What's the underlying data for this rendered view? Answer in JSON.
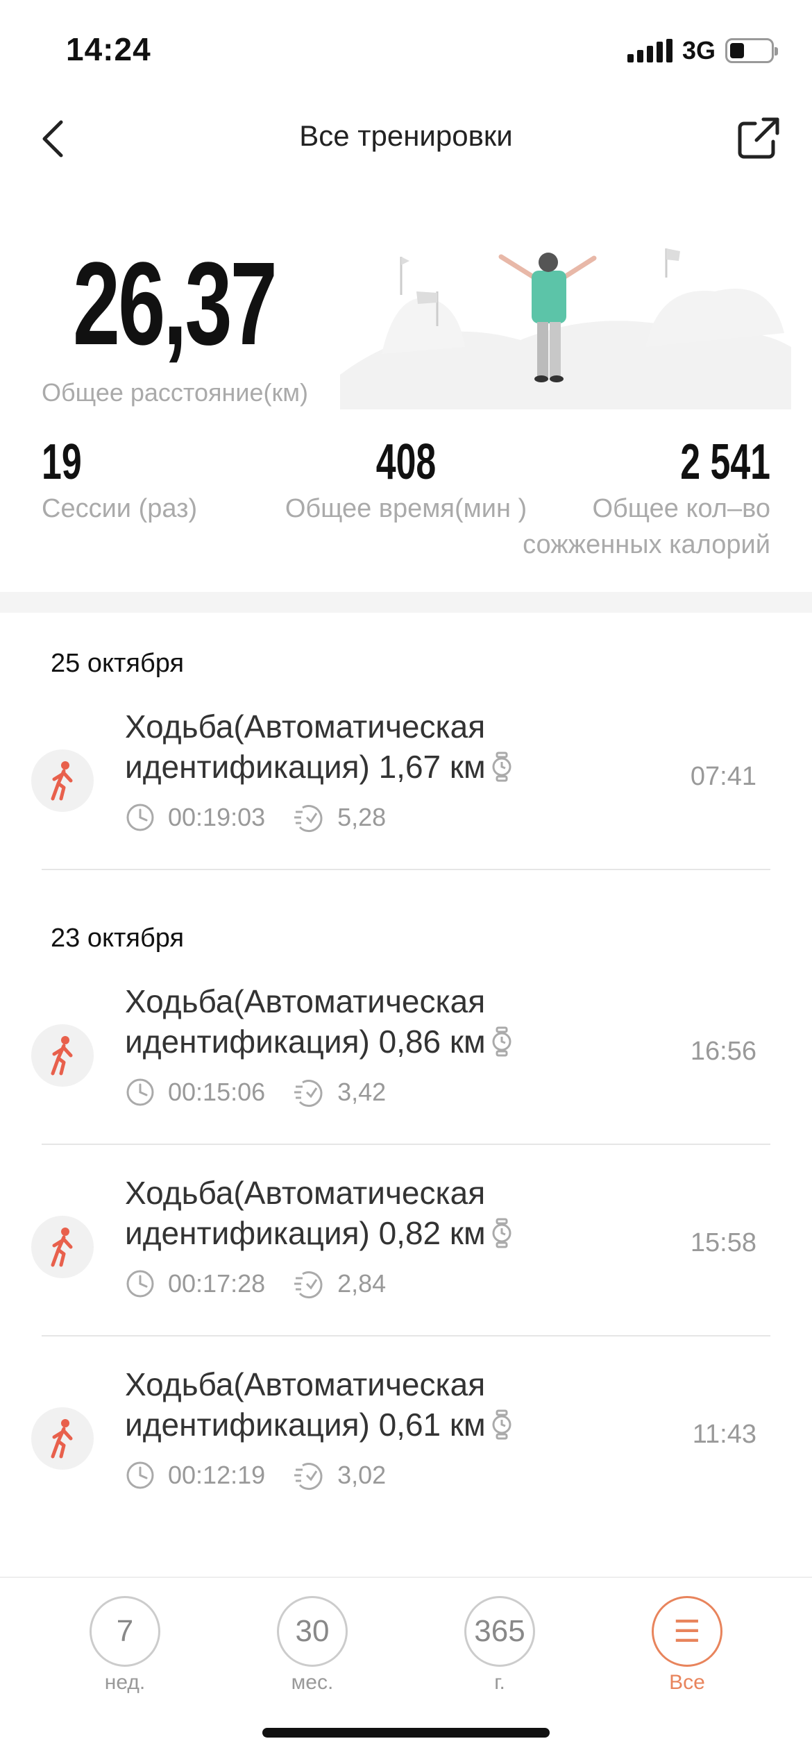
{
  "status_bar": {
    "time": "14:24",
    "network": "3G"
  },
  "nav": {
    "title": "Все тренировки"
  },
  "summary": {
    "total_distance": "26,37",
    "total_distance_label": "Общее расстояние(км)",
    "sessions_value": "19",
    "sessions_label": "Сессии (раз)",
    "time_value": "408",
    "time_label": "Общее время(мин )",
    "calories_value": "2 541",
    "calories_label": "Общее кол–во сожженных калорий"
  },
  "groups": [
    {
      "date": "25 октября",
      "workouts": [
        {
          "title": "Ходьба(Автоматическая идентификация) 1,67 км",
          "duration": "00:19:03",
          "pace": "5,28",
          "time": "07:41"
        }
      ]
    },
    {
      "date": "23 октября",
      "workouts": [
        {
          "title": "Ходьба(Автоматическая идентификация) 0,86 км",
          "duration": "00:15:06",
          "pace": "3,42",
          "time": "16:56"
        },
        {
          "title": "Ходьба(Автоматическая идентификация) 0,82 км",
          "duration": "00:17:28",
          "pace": "2,84",
          "time": "15:58"
        },
        {
          "title": "Ходьба(Автоматическая идентификация) 0,61 км",
          "duration": "00:12:19",
          "pace": "3,02",
          "time": "11:43"
        }
      ]
    }
  ],
  "bottom_tabs": [
    {
      "value": "7",
      "label": "нед."
    },
    {
      "value": "30",
      "label": "мес."
    },
    {
      "value": "365",
      "label": "г."
    },
    {
      "value": "☰",
      "label": "Все"
    }
  ],
  "colors": {
    "accent": "#e8845c",
    "walk_icon": "#e8604c"
  }
}
